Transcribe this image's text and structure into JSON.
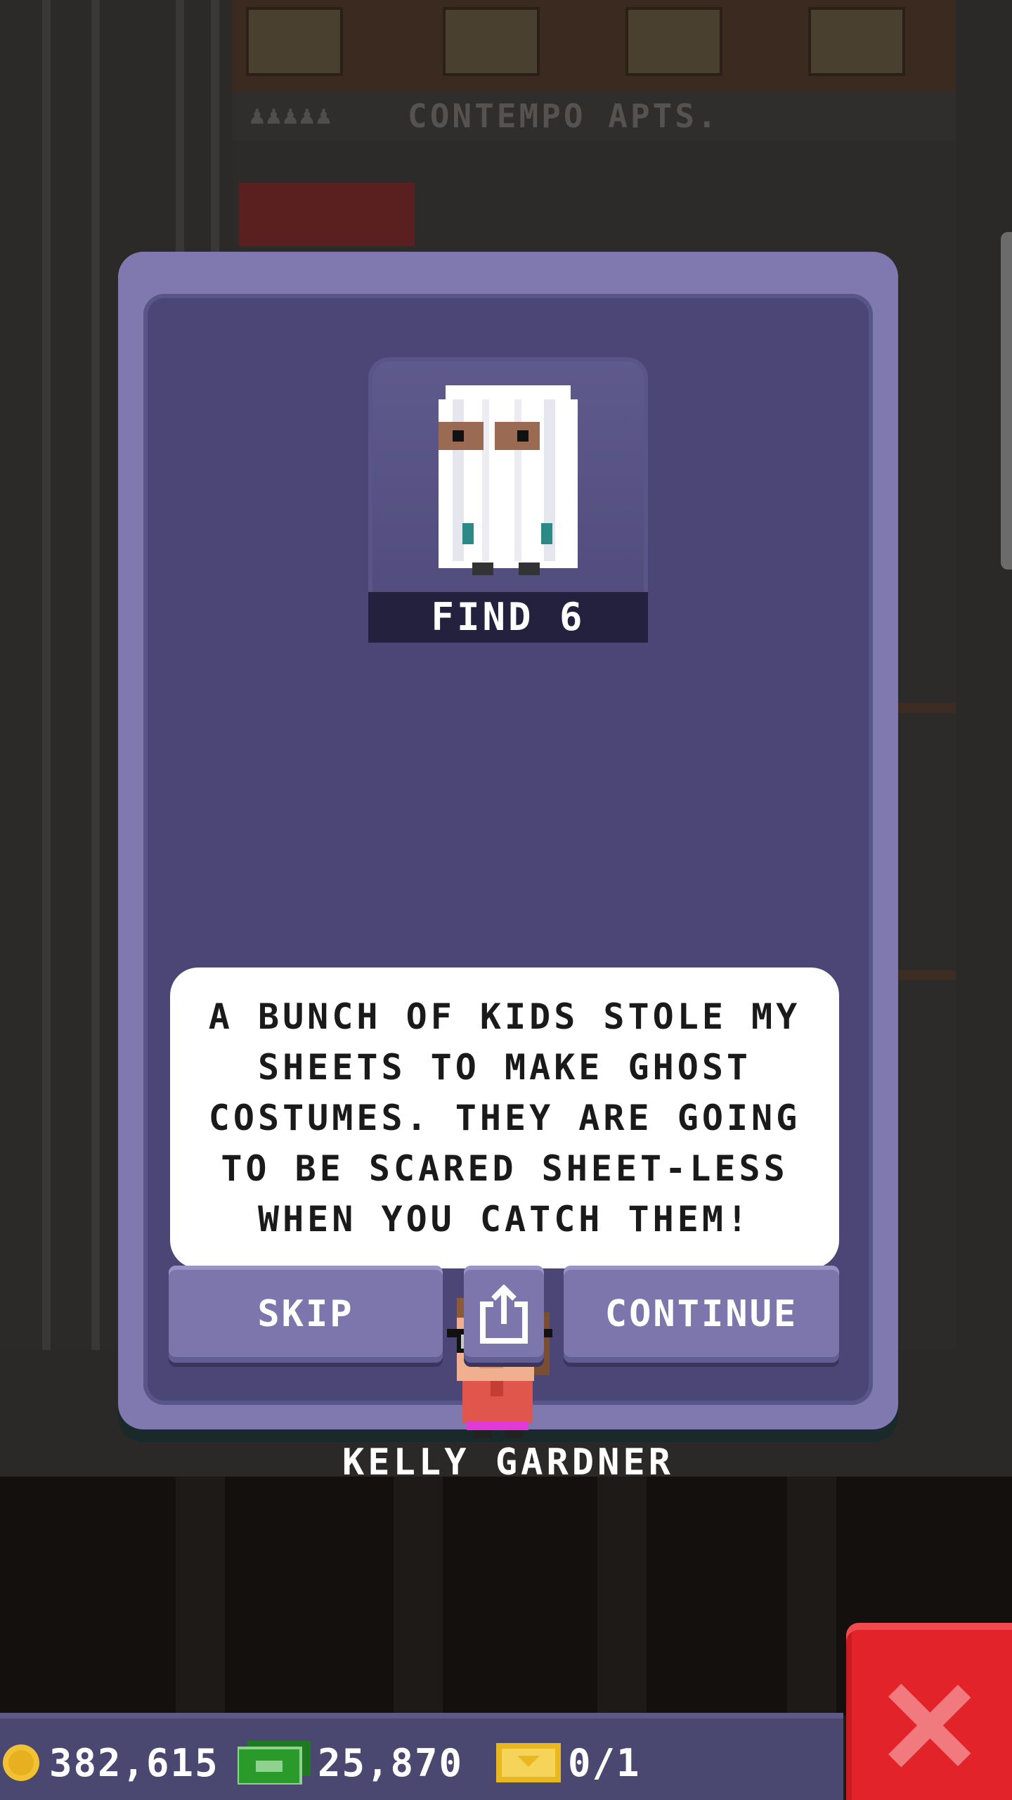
{
  "background": {
    "building_sign": "CONTEMPO APTS."
  },
  "mission": {
    "target_icon": "ghost-kid-icon",
    "find_label": "FIND 6",
    "message": "A BUNCH OF KIDS STOLE MY SHEETS TO MAKE GHOST COSTUMES. THEY ARE GOING TO BE SCARED SHEET-LESS WHEN YOU CATCH THEM!",
    "character_name": "KELLY GARDNER"
  },
  "buttons": {
    "skip": "SKIP",
    "share_icon": "share-icon",
    "continue": "CONTINUE"
  },
  "status_bar": {
    "coins": "382,615",
    "cash": "25,870",
    "tickets": "0/1"
  },
  "colors": {
    "modal_frame": "#7f79b0",
    "modal_panel": "#4b4676",
    "button": "#7c76ac",
    "close_button": "#e3232a",
    "coin": "#f2c232",
    "cash": "#2a9a2a",
    "ticket": "#e8b822"
  }
}
